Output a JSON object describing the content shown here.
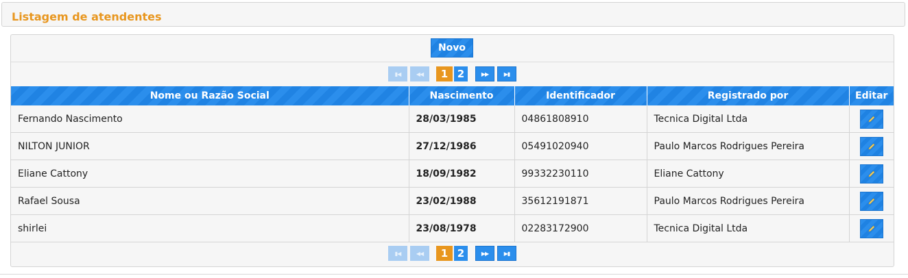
{
  "page": {
    "title": "Listagem de atendentes"
  },
  "toolbar": {
    "new_label": "Novo"
  },
  "pagination": {
    "pages": [
      "1",
      "2"
    ],
    "current": "1",
    "first_icon": "first-page-icon",
    "prev_icon": "prev-page-icon",
    "next_icon": "next-page-icon",
    "last_icon": "last-page-icon"
  },
  "table": {
    "columns": [
      "Nome ou Razão Social",
      "Nascimento",
      "Identificador",
      "Registrado por",
      "Editar"
    ],
    "rows": [
      {
        "name": "Fernando Nascimento",
        "birth": "28/03/1985",
        "id": "04861808910",
        "registered_by": "Tecnica Digital Ltda"
      },
      {
        "name": "NILTON JUNIOR",
        "birth": "27/12/1986",
        "id": "05491020940",
        "registered_by": "Paulo Marcos Rodrigues Pereira"
      },
      {
        "name": "Eliane Cattony",
        "birth": "18/09/1982",
        "id": "99332230110",
        "registered_by": "Eliane Cattony"
      },
      {
        "name": "Rafael Sousa",
        "birth": "23/02/1988",
        "id": "35612191871",
        "registered_by": "Paulo Marcos Rodrigues Pereira"
      },
      {
        "name": "shirlei",
        "birth": "23/08/1978",
        "id": "02283172900",
        "registered_by": "Tecnica Digital Ltda"
      }
    ],
    "edit_icon": "pencil-icon"
  },
  "colors": {
    "accent": "#2b8eec",
    "title": "#e8961e",
    "active_page": "#e8961e",
    "panel_bg": "#f6f6f6"
  }
}
